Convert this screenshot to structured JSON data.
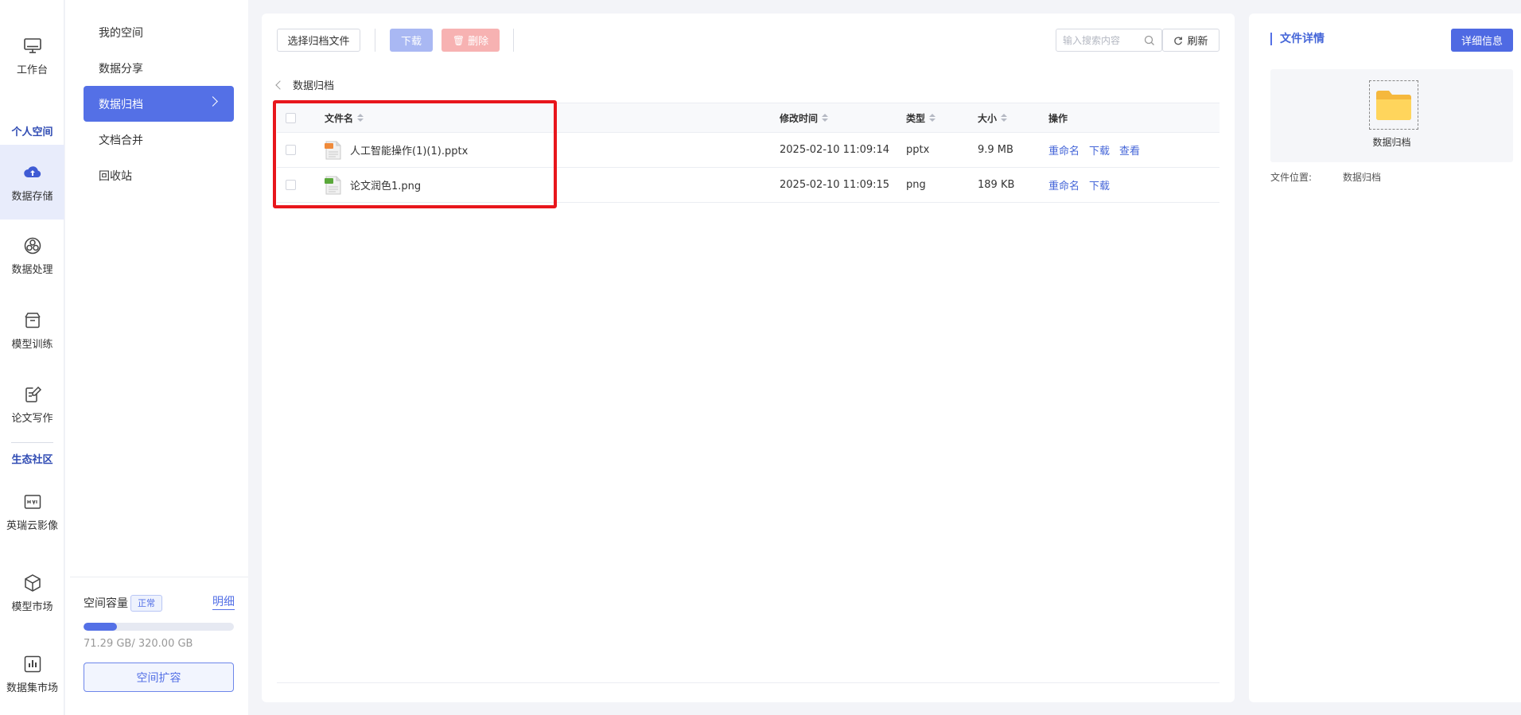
{
  "rail": {
    "workbench": "工作台",
    "section_personal": "个人空间",
    "data_storage": "数据存储",
    "data_processing": "数据处理",
    "model_training": "模型训练",
    "paper_writing": "论文写作",
    "section_eco": "生态社区",
    "cloud_image": "英瑞云影像",
    "model_market": "模型市场",
    "dataset_market": "数据集市场"
  },
  "menu": {
    "items": [
      {
        "label": "我的空间"
      },
      {
        "label": "数据分享"
      },
      {
        "label": "数据归档"
      },
      {
        "label": "文档合并"
      },
      {
        "label": "回收站"
      }
    ],
    "active_index": 2
  },
  "capacity": {
    "title": "空间容量",
    "badge": "正常",
    "detail_link": "明细",
    "used_fraction": 0.2228,
    "usage_text": "71.29 GB/ 320.00 GB",
    "expand_button": "空间扩容"
  },
  "toolbar": {
    "select_button": "选择归档文件",
    "download_button": "下载",
    "delete_button": "删除",
    "search_placeholder": "输入搜索内容",
    "refresh_button": "刷新"
  },
  "breadcrumb": {
    "current": "数据归档"
  },
  "table": {
    "columns": {
      "name": "文件名",
      "modified": "修改时间",
      "type": "类型",
      "size": "大小",
      "actions": "操作"
    },
    "rows": [
      {
        "name": "人工智能操作(1)(1).pptx",
        "modified": "2025-02-10 11:09:14",
        "type": "pptx",
        "size": "9.9 MB",
        "icon": "pptx-file-icon",
        "actions": [
          "重命名",
          "下载",
          "查看"
        ]
      },
      {
        "name": "论文润色1.png",
        "modified": "2025-02-10 11:09:15",
        "type": "png",
        "size": "189 KB",
        "icon": "image-file-icon",
        "actions": [
          "重命名",
          "下载"
        ]
      }
    ]
  },
  "detail": {
    "title": "文件详情",
    "button": "详细信息",
    "folder_name": "数据归档",
    "location_label": "文件位置:",
    "location_value": "数据归档"
  },
  "colors": {
    "accent": "#5470e6",
    "highlight": "#e8161c",
    "link": "#4566d8"
  }
}
